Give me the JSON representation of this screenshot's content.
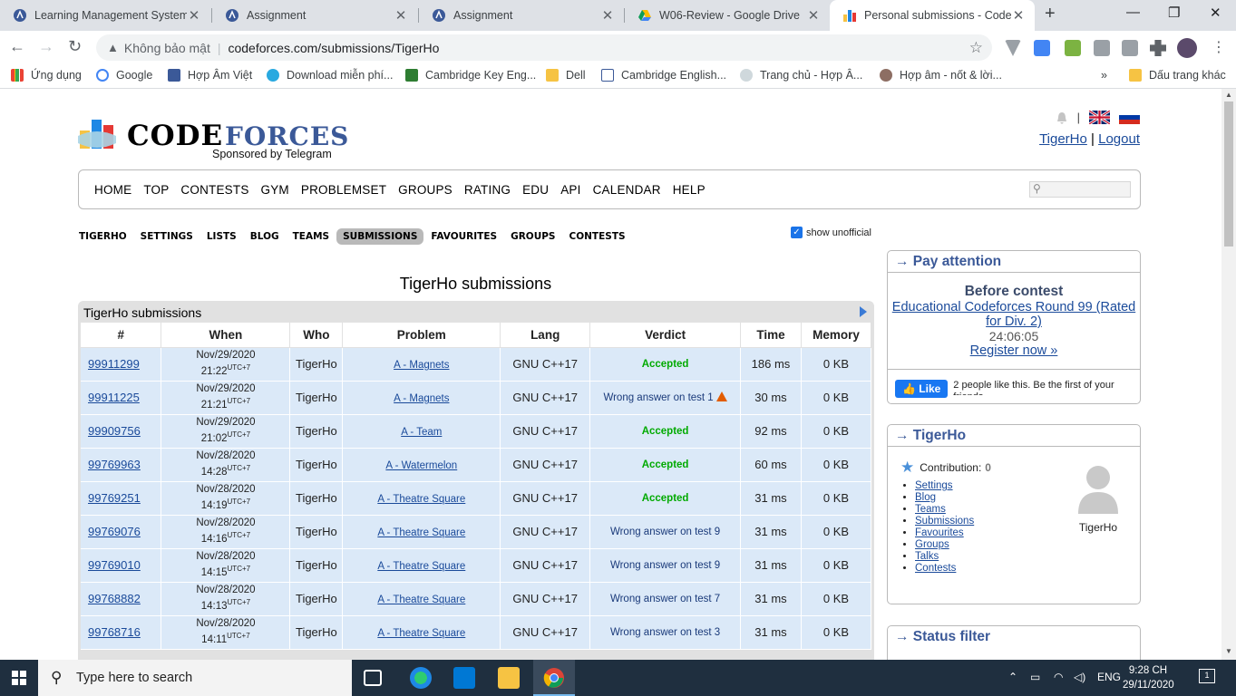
{
  "browser": {
    "tabs": [
      {
        "title": "Learning Management System"
      },
      {
        "title": "Assignment"
      },
      {
        "title": "Assignment"
      },
      {
        "title": "W06-Review - Google Drive"
      },
      {
        "title": "Personal submissions - Codeforces"
      }
    ],
    "new_tab": "+",
    "security": "Không bảo mật",
    "url": "codeforces.com/submissions/TigerHo",
    "bookmarks": [
      {
        "label": "Ứng dụng"
      },
      {
        "label": "Google"
      },
      {
        "label": "Hợp Âm Việt"
      },
      {
        "label": "Download miễn phí..."
      },
      {
        "label": "Cambridge Key Eng..."
      },
      {
        "label": "Dell"
      },
      {
        "label": "Cambridge English..."
      },
      {
        "label": "Trang chủ - Hợp Â..."
      },
      {
        "label": "Hợp âm - nốt & lời..."
      },
      {
        "label": "Dấu trang khác"
      }
    ]
  },
  "site": {
    "logo_word1": "CODE",
    "logo_word2": "FORCES",
    "sponsor": "Sponsored by Telegram",
    "user": "TigerHo",
    "logout": "Logout",
    "menu": [
      "HOME",
      "TOP",
      "CONTESTS",
      "GYM",
      "PROBLEMSET",
      "GROUPS",
      "RATING",
      "EDU",
      "API",
      "CALENDAR",
      "HELP"
    ],
    "subnav": [
      "TIGERHO",
      "SETTINGS",
      "LISTS",
      "BLOG",
      "TEAMS",
      "SUBMISSIONS",
      "FAVOURITES",
      "GROUPS",
      "CONTESTS"
    ],
    "show_unofficial": "show unofficial"
  },
  "submissions": {
    "heading": "TigerHo submissions",
    "caption": "TigerHo submissions",
    "columns": [
      "#",
      "When",
      "Who",
      "Problem",
      "Lang",
      "Verdict",
      "Time",
      "Memory"
    ],
    "tz": "UTC+7",
    "rows": [
      {
        "id": "99911299",
        "date": "Nov/29/2020",
        "time": "21:22",
        "who": "TigerHo",
        "problem": "A - Magnets",
        "lang": "GNU C++17",
        "verdict": "Accepted",
        "ok": true,
        "time_ms": "186 ms",
        "mem": "0 KB"
      },
      {
        "id": "99911225",
        "date": "Nov/29/2020",
        "time": "21:21",
        "who": "TigerHo",
        "problem": "A - Magnets",
        "lang": "GNU C++17",
        "verdict": "Wrong answer on test 1",
        "ok": false,
        "warn": true,
        "time_ms": "30 ms",
        "mem": "0 KB"
      },
      {
        "id": "99909756",
        "date": "Nov/29/2020",
        "time": "21:02",
        "who": "TigerHo",
        "problem": "A - Team",
        "lang": "GNU C++17",
        "verdict": "Accepted",
        "ok": true,
        "time_ms": "92 ms",
        "mem": "0 KB"
      },
      {
        "id": "99769963",
        "date": "Nov/28/2020",
        "time": "14:28",
        "who": "TigerHo",
        "problem": "A - Watermelon",
        "lang": "GNU C++17",
        "verdict": "Accepted",
        "ok": true,
        "time_ms": "60 ms",
        "mem": "0 KB"
      },
      {
        "id": "99769251",
        "date": "Nov/28/2020",
        "time": "14:19",
        "who": "TigerHo",
        "problem": "A - Theatre Square",
        "lang": "GNU C++17",
        "verdict": "Accepted",
        "ok": true,
        "time_ms": "31 ms",
        "mem": "0 KB"
      },
      {
        "id": "99769076",
        "date": "Nov/28/2020",
        "time": "14:16",
        "who": "TigerHo",
        "problem": "A - Theatre Square",
        "lang": "GNU C++17",
        "verdict": "Wrong answer on test 9",
        "ok": false,
        "time_ms": "31 ms",
        "mem": "0 KB"
      },
      {
        "id": "99769010",
        "date": "Nov/28/2020",
        "time": "14:15",
        "who": "TigerHo",
        "problem": "A - Theatre Square",
        "lang": "GNU C++17",
        "verdict": "Wrong answer on test 9",
        "ok": false,
        "time_ms": "31 ms",
        "mem": "0 KB"
      },
      {
        "id": "99768882",
        "date": "Nov/28/2020",
        "time": "14:13",
        "who": "TigerHo",
        "problem": "A - Theatre Square",
        "lang": "GNU C++17",
        "verdict": "Wrong answer on test 7",
        "ok": false,
        "time_ms": "31 ms",
        "mem": "0 KB"
      },
      {
        "id": "99768716",
        "date": "Nov/28/2020",
        "time": "14:11",
        "who": "TigerHo",
        "problem": "A - Theatre Square",
        "lang": "GNU C++17",
        "verdict": "Wrong answer on test 3",
        "ok": false,
        "time_ms": "31 ms",
        "mem": "0 KB"
      }
    ]
  },
  "sidebar": {
    "pay": {
      "title": "→ Pay attention",
      "before": "Before contest",
      "contest": "Educational Codeforces Round 99 (Rated for Div. 2)",
      "countdown": "24:06:05",
      "register": "Register now »",
      "like": "Like",
      "like_text": "2 people like this. Be the first of your friends."
    },
    "profile": {
      "title": "→ TigerHo",
      "contribution_label": "Contribution:",
      "contribution": "0",
      "links": [
        "Settings",
        "Blog",
        "Teams",
        "Submissions",
        "Favourites",
        "Groups",
        "Talks",
        "Contests"
      ],
      "name": "TigerHo"
    },
    "status": {
      "title": "→ Status filter"
    }
  },
  "taskbar": {
    "search_placeholder": "Type here to search",
    "lang": "ENG",
    "time": "9:28 CH",
    "date": "29/11/2020",
    "notif": "1"
  }
}
